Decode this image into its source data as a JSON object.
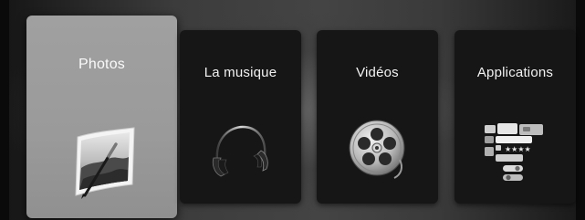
{
  "menu": {
    "tiles": [
      {
        "label": "Photos",
        "icon": "photos-icon",
        "selected": true
      },
      {
        "label": "La musique",
        "icon": "headphones-icon",
        "selected": false
      },
      {
        "label": "Vidéos",
        "icon": "film-reel-icon",
        "selected": false
      },
      {
        "label": "Applications",
        "icon": "apps-widgets-icon",
        "selected": false
      }
    ]
  },
  "colors": {
    "selected_tile": "#9c9c9c",
    "tile": "#161616",
    "label": "#f2f2f2"
  }
}
